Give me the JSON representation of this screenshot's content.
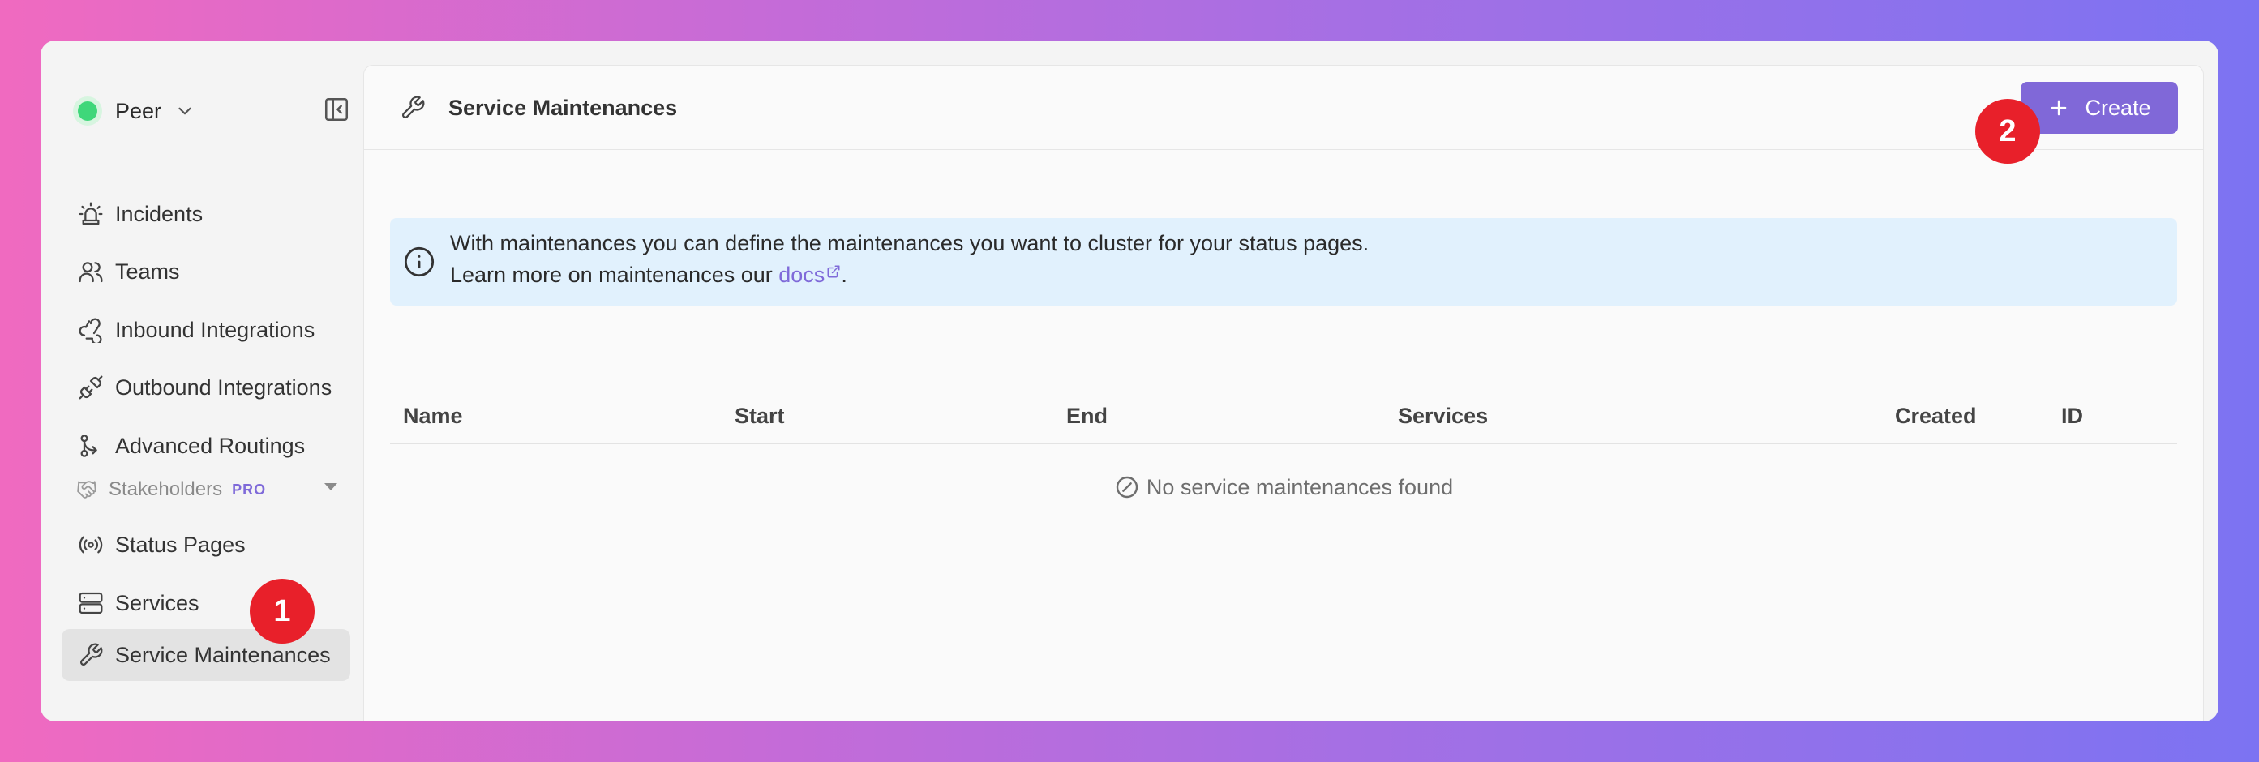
{
  "sidebar": {
    "org_name": "Peer",
    "items": [
      {
        "label": "Incidents",
        "icon": "siren-icon"
      },
      {
        "label": "Teams",
        "icon": "users-icon"
      },
      {
        "label": "Inbound Integrations",
        "icon": "webhook-icon"
      },
      {
        "label": "Outbound Integrations",
        "icon": "plug-icon"
      },
      {
        "label": "Advanced Routings",
        "icon": "route-icon"
      }
    ],
    "section": {
      "label": "Stakeholders",
      "badge": "PRO",
      "items": [
        {
          "label": "Status Pages",
          "icon": "broadcast-icon"
        },
        {
          "label": "Services",
          "icon": "server-icon"
        },
        {
          "label": "Service Maintenances",
          "icon": "wrench-icon",
          "active": true
        }
      ]
    }
  },
  "header": {
    "title": "Service Maintenances",
    "create_label": "Create"
  },
  "info_banner": {
    "line1": "With maintenances you can define the maintenances you want to cluster for your status pages.",
    "line2_prefix": "Learn more on maintenances our",
    "link_text": "docs",
    "line2_suffix": "."
  },
  "table": {
    "columns": [
      "Name",
      "Start",
      "End",
      "Services",
      "Created",
      "ID"
    ],
    "empty_message": "No service maintenances found"
  },
  "annotations": {
    "marker1": "1",
    "marker2": "2"
  },
  "colors": {
    "accent": "#8068d8",
    "status_green": "#3fd77a",
    "marker_red": "#e8202a",
    "info_bg": "#e1f1fd"
  }
}
